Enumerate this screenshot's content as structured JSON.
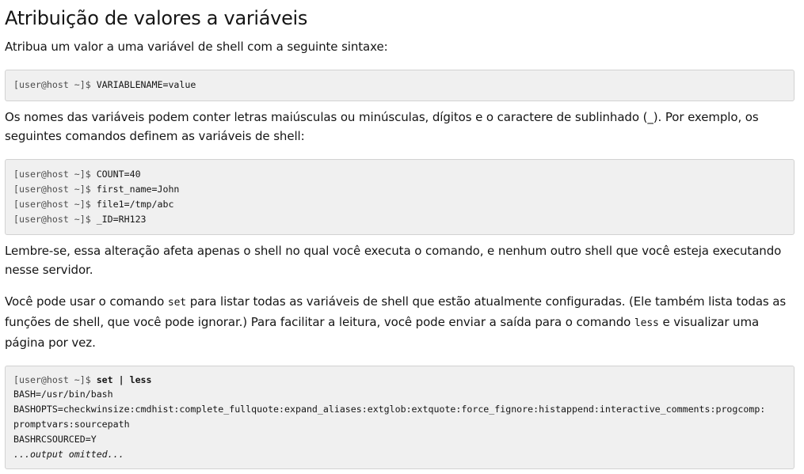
{
  "heading": "Atribuição de valores a variáveis",
  "para1": "Atribua um valor a uma variável de shell com a seguinte sintaxe:",
  "code1": {
    "prompt": "[user@host ~]$ ",
    "command": "VARIABLENAME=value"
  },
  "para2": "Os nomes das variáveis podem conter letras maiúsculas ou minúsculas, dígitos e o caractere de sublinhado (_). Por exemplo, os seguintes comandos definem as variáveis de shell:",
  "code2": {
    "lines": [
      {
        "prompt": "[user@host ~]$ ",
        "command": "COUNT=40"
      },
      {
        "prompt": "[user@host ~]$ ",
        "command": "first_name=John"
      },
      {
        "prompt": "[user@host ~]$ ",
        "command": "file1=/tmp/abc"
      },
      {
        "prompt": "[user@host ~]$ ",
        "command": "_ID=RH123"
      }
    ]
  },
  "para3": "Lembre-se, essa alteração afeta apenas o shell no qual você executa o comando, e nenhum outro shell que você esteja executando nesse servidor.",
  "para4": {
    "part1": "Você pode usar o comando ",
    "code_a": "set",
    "part2": " para listar todas as variáveis de shell que estão atualmente configuradas. (Ele também lista todas as funções de shell, que você pode ignorar.) Para facilitar a leitura, você pode enviar a saída para o comando ",
    "code_b": "less",
    "part3": " e visualizar uma página por vez."
  },
  "code3": {
    "prompt": "[user@host ~]$ ",
    "command": "set | less",
    "output": [
      "BASH=/usr/bin/bash",
      "BASHOPTS=checkwinsize:cmdhist:complete_fullquote:expand_aliases:extglob:extquote:force_fignore:histappend:interactive_comments:progcomp:",
      "promptvars:sourcepath",
      "BASHRCSOURCED=Y"
    ],
    "omitted": "...output omitted..."
  }
}
